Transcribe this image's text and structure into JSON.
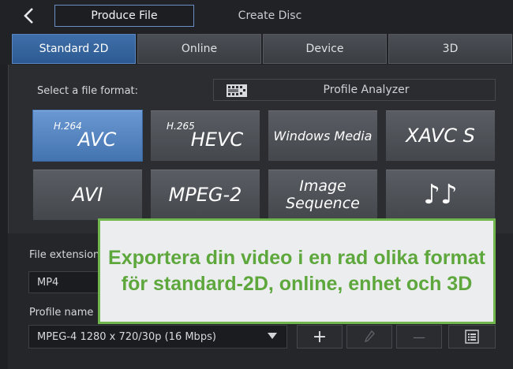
{
  "topbar": {
    "produce_label": "Produce File",
    "disc_label": "Create Disc"
  },
  "tabs": [
    "Standard 2D",
    "Online",
    "Device",
    "3D"
  ],
  "format_section": {
    "select_label": "Select a file format:",
    "analyzer_label": "Profile Analyzer"
  },
  "formats": {
    "avc": {
      "super": "H.264",
      "main": "AVC"
    },
    "hevc": {
      "super": "H.265",
      "main": "HEVC"
    },
    "wmv": "Windows Media",
    "xavc": "XAVC S",
    "avi": "AVI",
    "mpeg2": "MPEG-2",
    "imgseq": "Image Sequence",
    "audio": "♪♪"
  },
  "settings": {
    "file_ext_label": "File extension",
    "file_ext_value": "MP4",
    "profile_label": "Profile name",
    "profile_value": "MPEG-4 1280 x 720/30p (16 Mbps)",
    "add_button": "+",
    "remove_button": "—"
  },
  "overlay": {
    "text": "Exportera din video i en rad olika format för standard-2D, online, enhet och 3D"
  },
  "colors": {
    "accent_blue": "#4474b0",
    "overlay_green": "#5da73c"
  }
}
